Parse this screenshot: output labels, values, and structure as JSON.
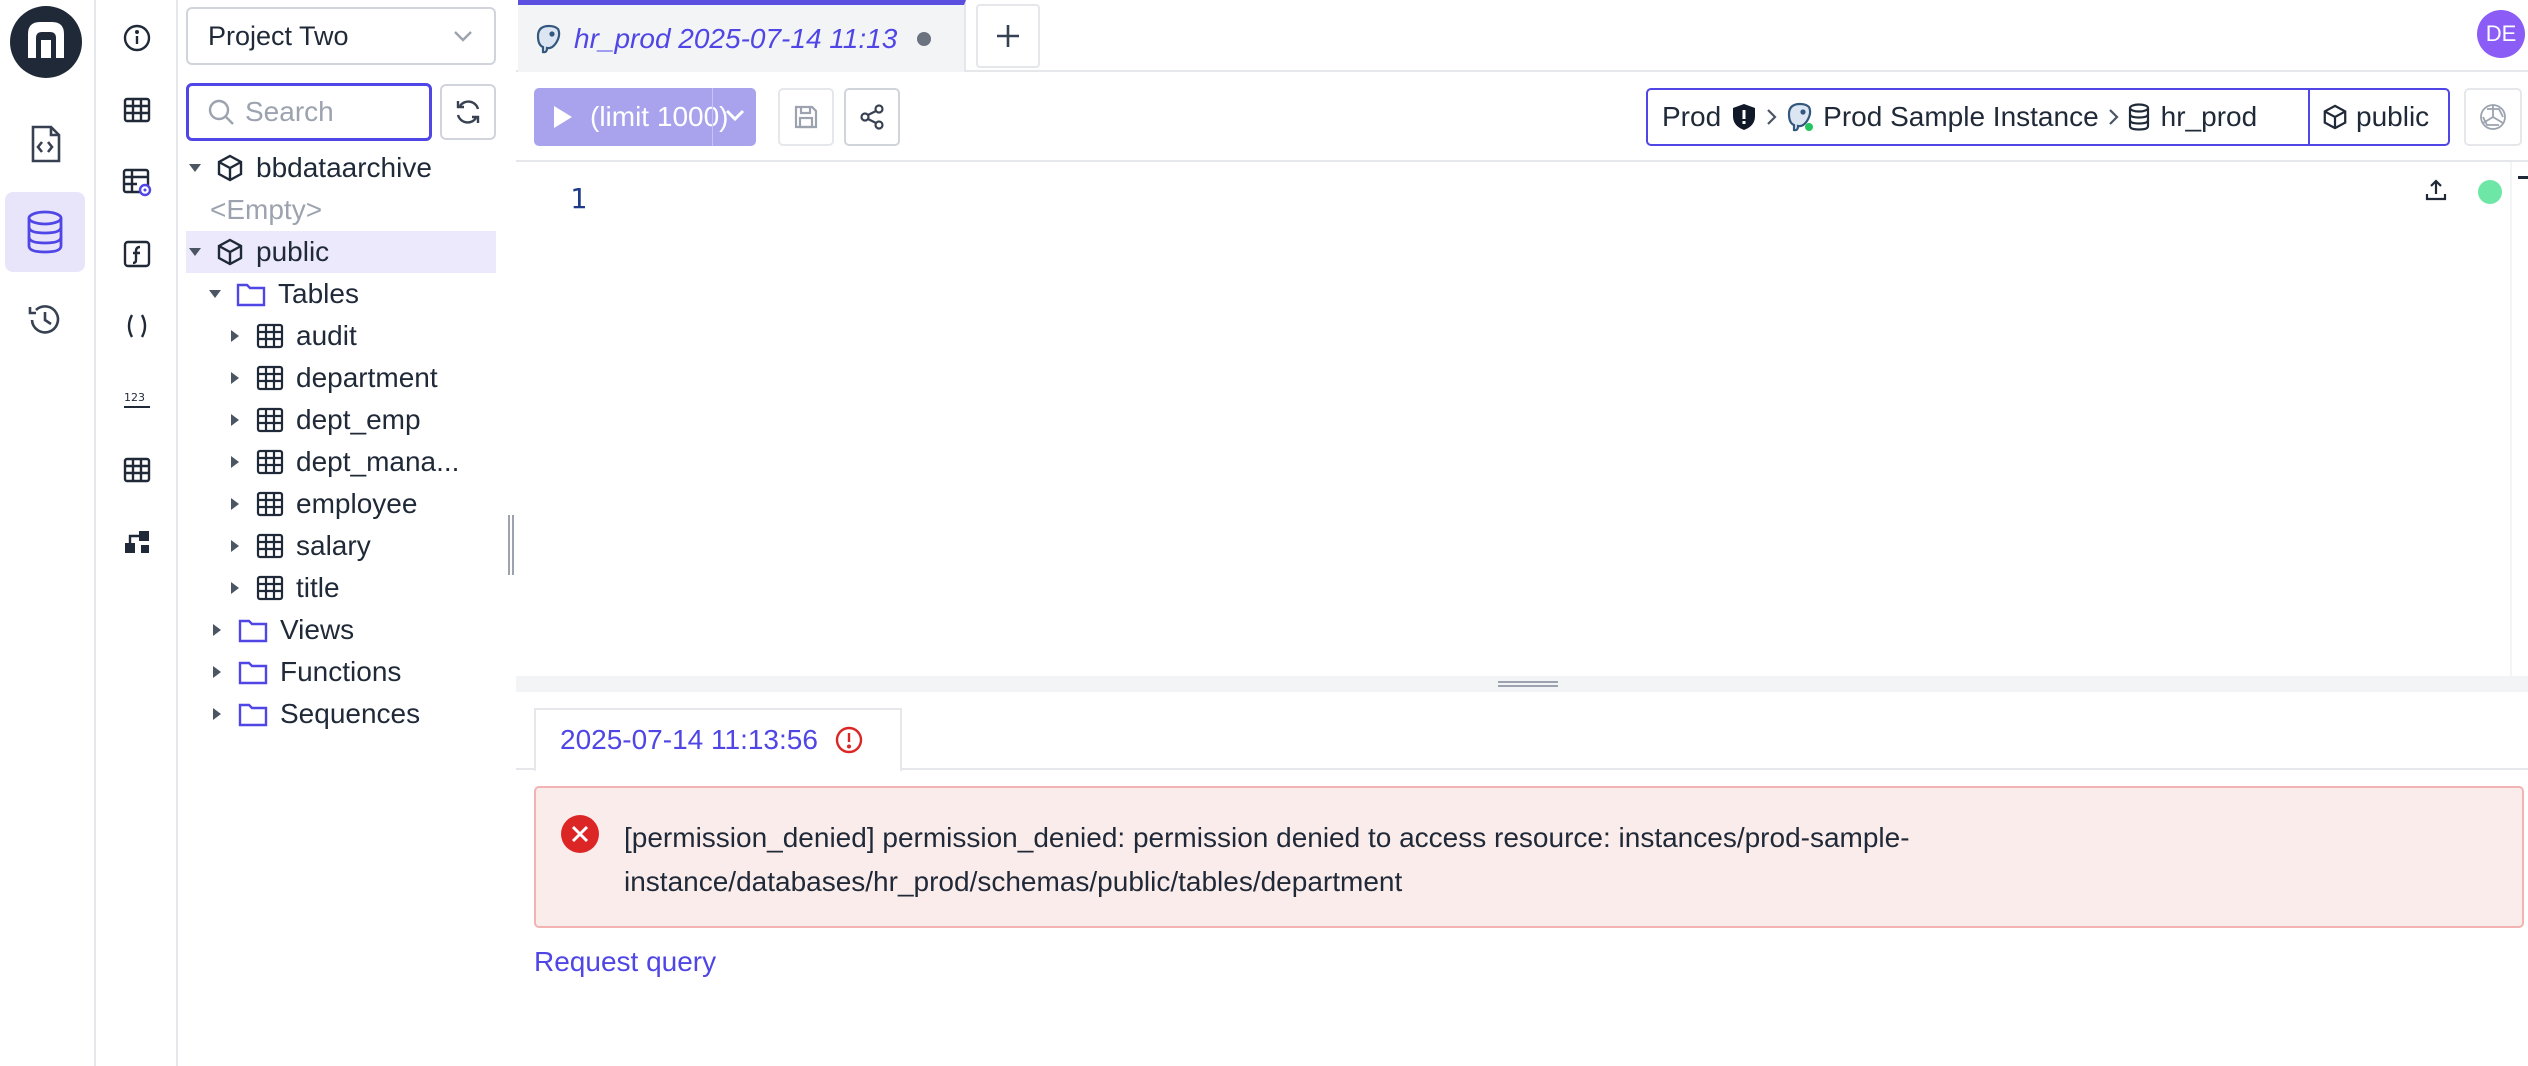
{
  "project": {
    "name": "Project Two"
  },
  "search": {
    "placeholder": "Search"
  },
  "tree": {
    "archive_schema": "bbdataarchive",
    "empty_label": "<Empty>",
    "public_schema": "public",
    "tables_folder": "Tables",
    "tables": [
      "audit",
      "department",
      "dept_emp",
      "dept_mana...",
      "employee",
      "salary",
      "title"
    ],
    "views_folder": "Views",
    "functions_folder": "Functions",
    "sequences_folder": "Sequences"
  },
  "tab": {
    "title": "hr_prod 2025-07-14 11:13"
  },
  "user": {
    "initials": "DE"
  },
  "toolbar": {
    "run_label": "(limit 1000)"
  },
  "context": {
    "environment": "Prod",
    "instance": "Prod Sample Instance",
    "database": "hr_prod",
    "schema": "public"
  },
  "editor": {
    "line_number": "1"
  },
  "result": {
    "tab_label": "2025-07-14 11:13:56",
    "error_message": "[permission_denied] permission_denied: permission denied to access resource: instances/prod-sample-instance/databases/hr_prod/schemas/public/tables/department",
    "request_query_label": "Request query"
  },
  "colors": {
    "accent": "#4f46e5",
    "run_button": "#a8a3ec",
    "error_bg": "#fbecec",
    "error_icon": "#dc2626",
    "status_ok": "#6ee7a6",
    "avatar": "#8b5cf6"
  }
}
